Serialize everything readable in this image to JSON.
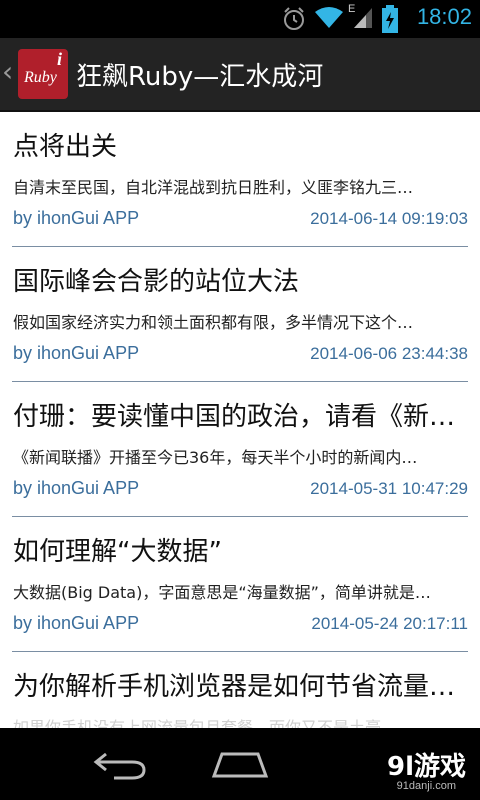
{
  "status_bar": {
    "time": "18:02",
    "icons": [
      "alarm-icon",
      "wifi-icon",
      "signal-icon",
      "battery-charging-icon"
    ],
    "network_type": "E"
  },
  "action_bar": {
    "up_icon": "chevron-left-icon",
    "logo_text": "Ruby",
    "logo_mark": "i",
    "title": "狂飙Ruby—汇水成河"
  },
  "articles": [
    {
      "title": "点将出关",
      "summary": "自清末至民国，自北洋混战到抗日胜利，义匪李铭九三…",
      "author": "by ihonGui APP",
      "date": "2014-06-14 09:19:03"
    },
    {
      "title": "国际峰会合影的站位大法",
      "summary": "假如国家经济实力和领土面积都有限，多半情况下这个…",
      "author": "by ihonGui APP",
      "date": "2014-06-06 23:44:38"
    },
    {
      "title": "付珊：要读懂中国的政治，请看《新…",
      "summary": "《新闻联播》开播至今已36年，每天半个小时的新闻内…",
      "author": "by ihonGui APP",
      "date": "2014-05-31 10:47:29"
    },
    {
      "title": "如何理解“大数据”",
      "summary": "大数据(Big Data)，字面意思是“海量数据”，简单讲就是…",
      "author": "by ihonGui APP",
      "date": "2014-05-24 20:17:11"
    },
    {
      "title": "为你解析手机浏览器是如何节省流量…",
      "summary": "如果你手机没有上网流量包月套餐，而你又不是土豪",
      "author": "",
      "date": ""
    }
  ],
  "nav_bar": {
    "icons": [
      "back-icon",
      "home-icon"
    ],
    "watermark": "9l游戏",
    "watermark_url": "91danji.com"
  },
  "colors": {
    "accent_blue": "#33b5e5",
    "meta_text": "#3b6e9c",
    "logo_red": "#b01f2b",
    "action_bar": "#232323"
  }
}
